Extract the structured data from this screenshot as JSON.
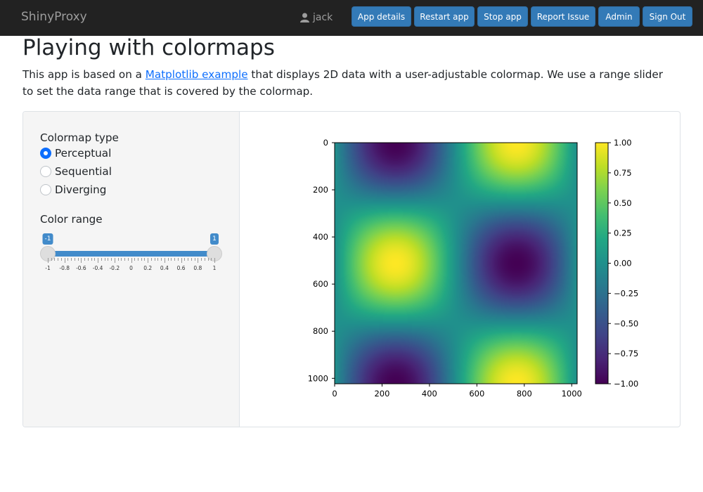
{
  "navbar": {
    "brand": "ShinyProxy",
    "user": "jack",
    "buttons": [
      "App details",
      "Restart app",
      "Stop app",
      "Report Issue",
      "Admin",
      "Sign Out"
    ]
  },
  "page": {
    "title": "Playing with colormaps",
    "intro_before": "This app is based on a ",
    "intro_link": "Matplotlib example",
    "intro_after": " that displays 2D data with a user-adjustable colormap. We use a range slider to set the data range that is covered by the colormap."
  },
  "sidebar": {
    "colormap_label": "Colormap type",
    "colormap_options": [
      "Perceptual",
      "Sequential",
      "Diverging"
    ],
    "colormap_selected": "Perceptual",
    "range_label": "Color range",
    "range_min": "-1",
    "range_max": "1",
    "range_ticks": [
      "-1",
      "-0.8",
      "-0.6",
      "-0.4",
      "-0.2",
      "0",
      "0.2",
      "0.4",
      "0.6",
      "0.8",
      "1"
    ]
  },
  "chart_data": {
    "type": "heatmap",
    "colormap": "viridis",
    "function": "-sin(2*pi*x/1024)*cos(2*pi*y/1024)",
    "x_ticks": [
      "0",
      "200",
      "400",
      "600",
      "800",
      "1000"
    ],
    "y_ticks": [
      "0",
      "200",
      "400",
      "600",
      "800",
      "1000"
    ],
    "xlim": [
      0,
      1023
    ],
    "ylim": [
      1023,
      0
    ],
    "colorbar": {
      "ticks": [
        "1.00",
        "0.75",
        "0.50",
        "0.25",
        "0.00",
        "−0.25",
        "−0.50",
        "−0.75",
        "−1.00"
      ],
      "range": [
        -1,
        1
      ]
    }
  },
  "colors": {
    "navbar_bg": "#222222",
    "button_bg": "#337ab7",
    "link": "#0d6efd",
    "slider_bar": "#428bca"
  }
}
